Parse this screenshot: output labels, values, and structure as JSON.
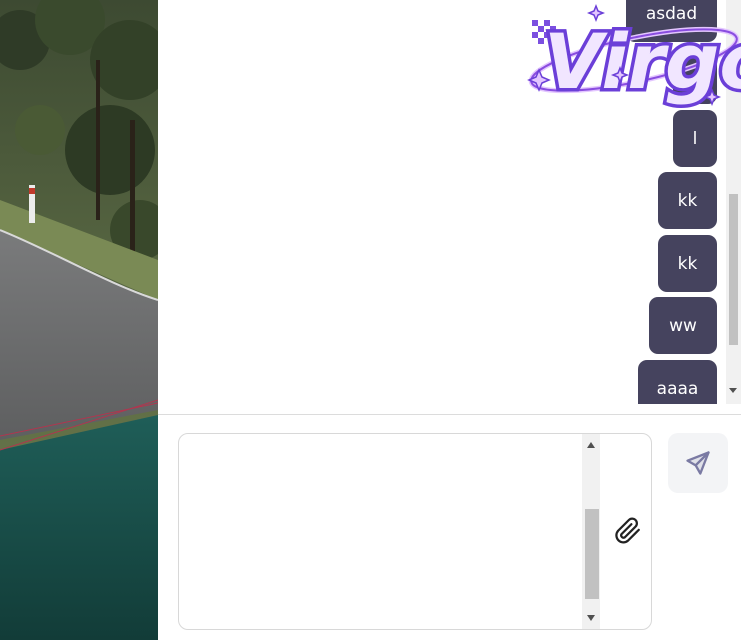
{
  "chat": {
    "messages": [
      {
        "text": "asdad"
      },
      {
        "text": ""
      },
      {
        "text": ""
      },
      {
        "text": "l"
      },
      {
        "text": "kk"
      },
      {
        "text": "kk"
      },
      {
        "text": "ww"
      },
      {
        "text": "aaaa"
      }
    ]
  },
  "composer": {
    "value": "",
    "placeholder": ""
  },
  "icons": {
    "attach": "paperclip-icon",
    "send": "send-icon"
  },
  "logo": {
    "text": "Virgo"
  },
  "colors": {
    "bubble": "#45435e",
    "send_icon": "#7a7aa3",
    "logo_purple": "#8a4de0",
    "logo_light": "#e3c6ff"
  }
}
